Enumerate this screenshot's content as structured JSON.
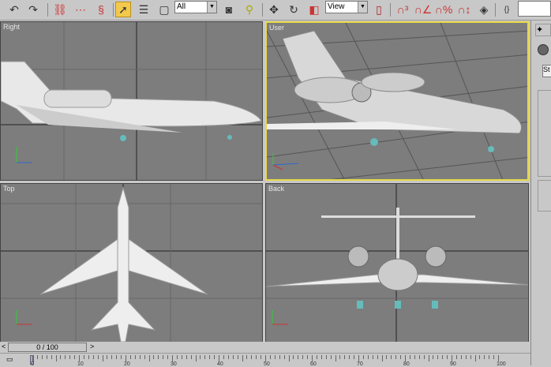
{
  "toolbar": {
    "icons": [
      "undo-icon",
      "redo-icon",
      "select-and-link-icon",
      "unlink-icon",
      "bind-space-warp-icon",
      "select-object-icon",
      "select-by-name-icon",
      "rectangular-selection-icon",
      "window-crossing-icon",
      "select-manipulate-icon",
      "select-move-icon",
      "select-rotate-icon",
      "select-scale-icon",
      "use-pivot-center-icon",
      "snaps-toggle-icon",
      "angle-snap-icon",
      "percent-snap-icon",
      "spinner-snap-icon",
      "edit-named-selections-icon",
      "mirror-icon"
    ],
    "filter_value": "All",
    "coord_value": "View"
  },
  "viewports": [
    {
      "label": "Right",
      "active": false
    },
    {
      "label": "User",
      "active": true
    },
    {
      "label": "Top",
      "active": false
    },
    {
      "label": "Back",
      "active": false
    }
  ],
  "command_panel": {
    "tab": "create-icon",
    "field": "St"
  },
  "timeline": {
    "slider_text": "0 / 100",
    "prev": "<",
    "next": ">",
    "ticks": [
      "0",
      "10",
      "20",
      "30",
      "40",
      "50",
      "60",
      "70",
      "80",
      "90",
      "100"
    ]
  },
  "colors": {
    "active_border": "#e8d84a",
    "viewport_bg": "#7d7d7d"
  }
}
